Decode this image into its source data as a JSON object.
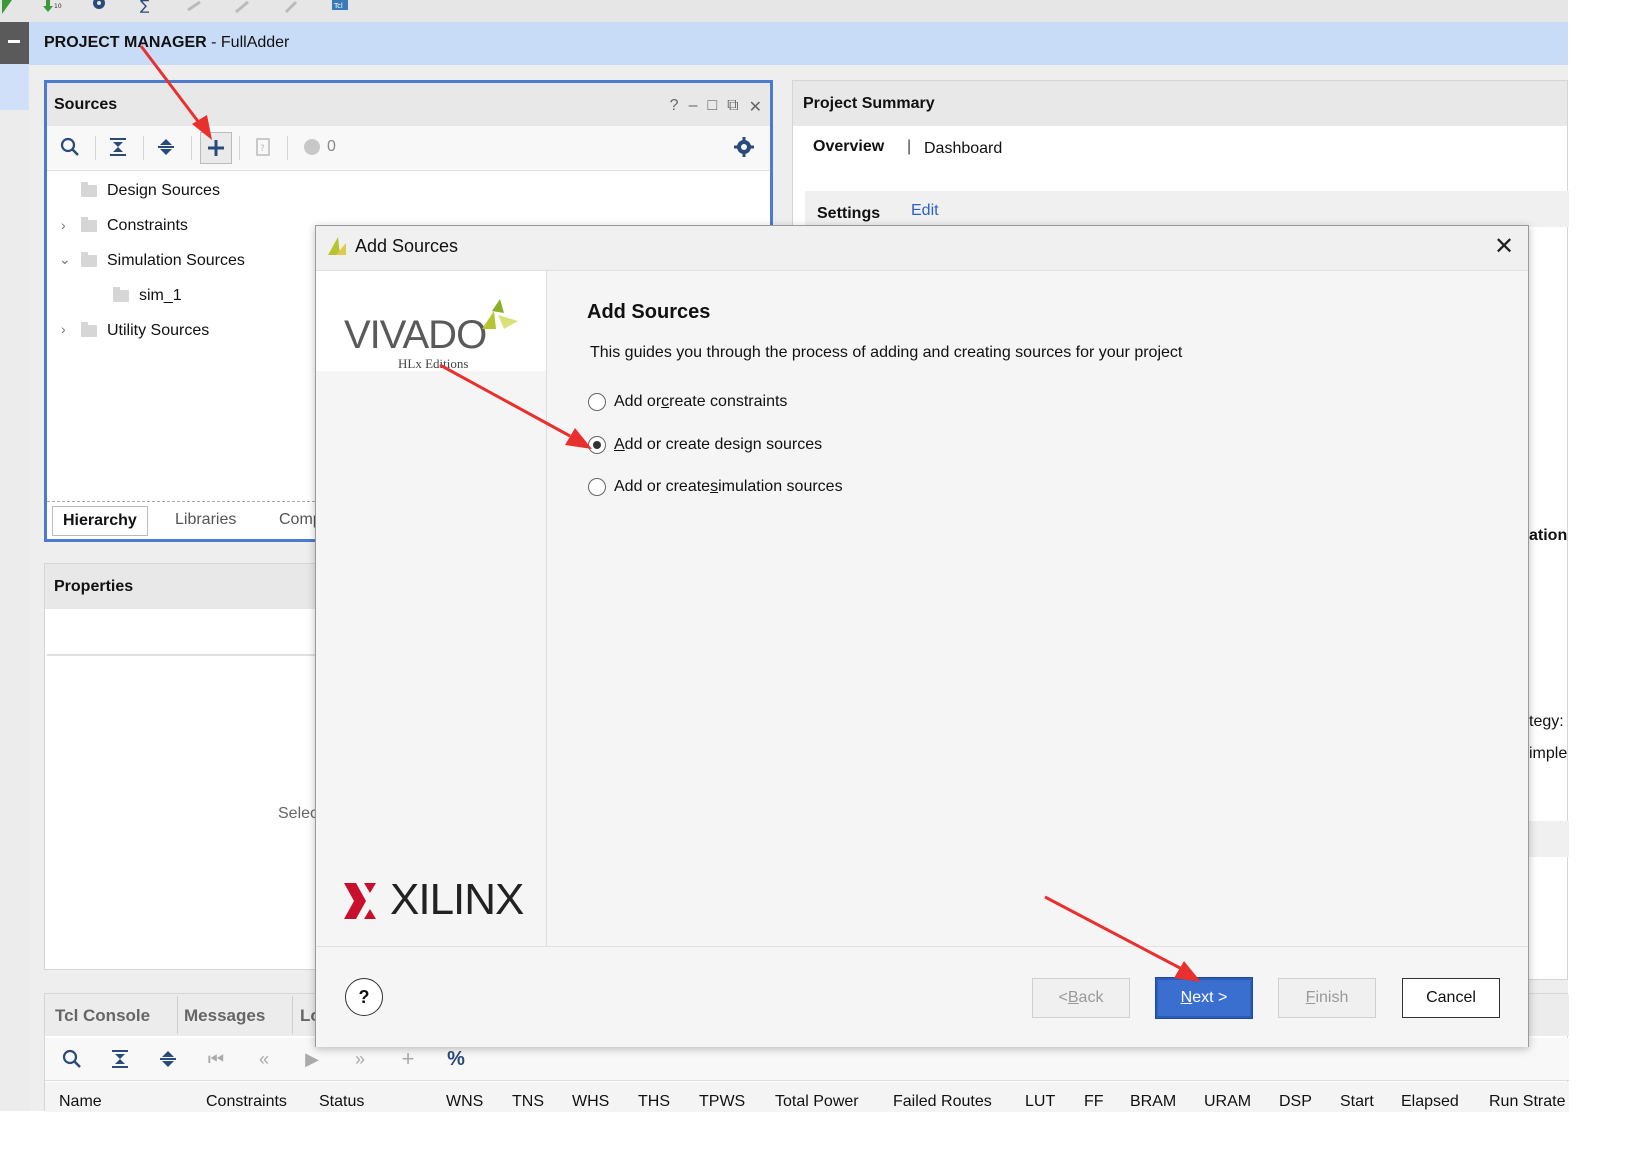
{
  "header": {
    "title_bold": "PROJECT MANAGER",
    "title_rest": " - FullAdder"
  },
  "top_toolbar": {
    "icons": [
      "run-icon",
      "download-icon",
      "gear-icon",
      "sigma-icon",
      "ruler-icon",
      "wand-icon",
      "pin-icon",
      "tcl-icon"
    ]
  },
  "sources": {
    "title": "Sources",
    "controls": [
      "?",
      "–",
      "□",
      "⧉",
      "✕"
    ],
    "count": "0",
    "tree": [
      {
        "label": "Design Sources"
      },
      {
        "label": "Constraints"
      },
      {
        "label": "Simulation Sources"
      },
      {
        "label": "sim_1"
      },
      {
        "label": "Utility Sources"
      }
    ],
    "tabs": [
      "Hierarchy",
      "Libraries",
      "Comp"
    ]
  },
  "properties": {
    "title": "Properties",
    "placeholder": "Selec"
  },
  "summary": {
    "title": "Project Summary",
    "tab_overview": "Overview",
    "tab_sep": "|",
    "tab_dashboard": "Dashboard",
    "settings": "Settings",
    "edit": "Edit",
    "partial1": "ation",
    "partial2": "tegy:",
    "partial3": "imple"
  },
  "console": {
    "tabs": [
      "Tcl Console",
      "Messages",
      "Lo"
    ],
    "columns": [
      "Name",
      "Constraints",
      "Status",
      "WNS",
      "TNS",
      "WHS",
      "THS",
      "TPWS",
      "Total Power",
      "Failed Routes",
      "LUT",
      "FF",
      "BRAM",
      "URAM",
      "DSP",
      "Start",
      "Elapsed",
      "Run Strate"
    ]
  },
  "dialog": {
    "title": "Add Sources",
    "logo_vivado": "VIVADO",
    "logo_sub": "HLx Editions",
    "logo_xilinx": "XILINX",
    "heading": "Add Sources",
    "description": "This guides you through the process of adding and creating sources for your project",
    "options": [
      {
        "pre": "Add or ",
        "u": "c",
        "post": "reate constraints",
        "checked": false
      },
      {
        "pre": "",
        "u": "A",
        "post": "dd or create design sources",
        "checked": true
      },
      {
        "pre": "Add or create ",
        "u": "s",
        "post": "imulation sources",
        "checked": false
      }
    ],
    "help": "?",
    "back": {
      "pre": "< ",
      "u": "B",
      "post": "ack"
    },
    "next": {
      "pre": "",
      "u": "N",
      "post": "ext >"
    },
    "finish": {
      "pre": "",
      "u": "F",
      "post": "inish"
    },
    "cancel": "Cancel"
  },
  "colors": {
    "accent": "#3a6fd0",
    "header": "#c9dcf7",
    "arrow": "#e8312f",
    "xilinx_red": "#c8102e"
  }
}
